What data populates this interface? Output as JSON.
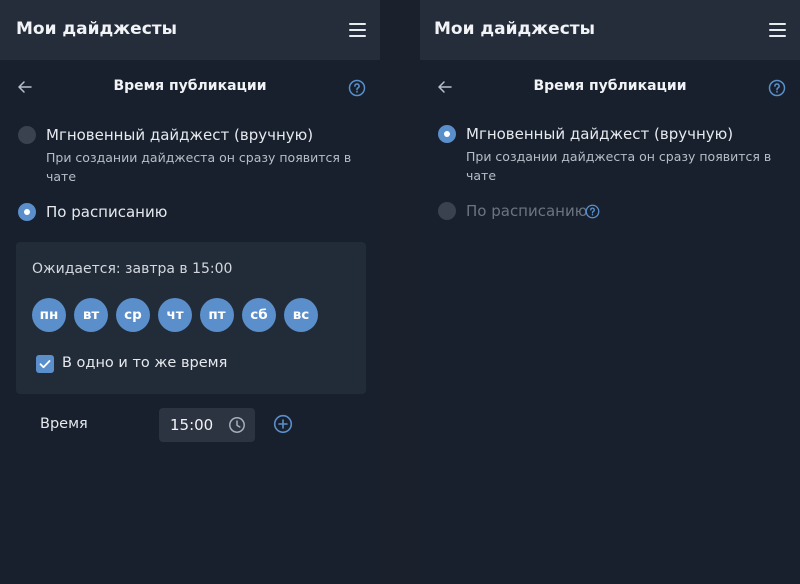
{
  "app": {
    "title": "Мои дайджесты",
    "menu_icon": "menu-icon"
  },
  "section": {
    "title": "Время публикации",
    "back_icon": "arrow-left-icon",
    "help_icon": "question-circle-icon"
  },
  "left_panel": {
    "options": [
      {
        "label": "Мгновенный дайджест (вручную)",
        "description": "При создании дайджеста он сразу появится в чате",
        "selected": false
      },
      {
        "label": "По расписанию",
        "selected": true
      }
    ],
    "schedule": {
      "expected": "Ожидается: завтра в 15:00",
      "days": [
        "пн",
        "вт",
        "ср",
        "чт",
        "пт",
        "сб",
        "вс"
      ],
      "same_time_label": "В одно и то же время",
      "same_time_checked": true,
      "time_label": "Время",
      "time_value": "15:00",
      "clock_icon": "clock-icon",
      "add_icon": "plus-circle-icon"
    }
  },
  "right_panel": {
    "options": [
      {
        "label": "Мгновенный дайджест (вручную)",
        "description": "При создании дайджеста он сразу появится в чате",
        "selected": true
      },
      {
        "label": "По расписанию",
        "selected": false,
        "disabled": true
      }
    ]
  },
  "colors": {
    "accent": "#5a8fcb",
    "panel_bg": "#17202c",
    "header_bg": "#252d3a",
    "card_bg": "#222b38"
  }
}
